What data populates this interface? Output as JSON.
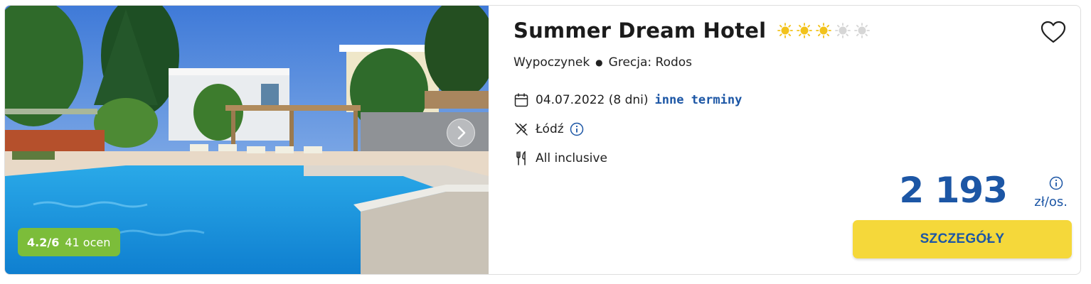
{
  "hotel": {
    "name": "Summer Dream Hotel",
    "stars_filled": 3,
    "stars_total": 5,
    "category": "Wypoczynek",
    "location": "Grecja: Rodos"
  },
  "rating": {
    "score": "4.2/6",
    "count": "41 ocen"
  },
  "trip": {
    "date": "04.07.2022 (8 dni)",
    "other_dates_label": "inne terminy",
    "departure": "Łódź",
    "board": "All inclusive"
  },
  "price": {
    "amount": "2 193",
    "unit": "zł/os."
  },
  "actions": {
    "details_label": "SZCZEGÓŁY"
  },
  "icons": {
    "favorite": "heart-icon",
    "calendar": "calendar-icon",
    "flight": "plane-off-icon",
    "board": "cutlery-icon",
    "info": "info-icon",
    "next": "chevron-right-icon"
  },
  "colors": {
    "brand_blue": "#1c56a5",
    "cta_yellow": "#f5d83a",
    "rating_green": "#7cbd3a",
    "star_gold": "#f2c21b",
    "star_empty": "#d6d6d6"
  }
}
